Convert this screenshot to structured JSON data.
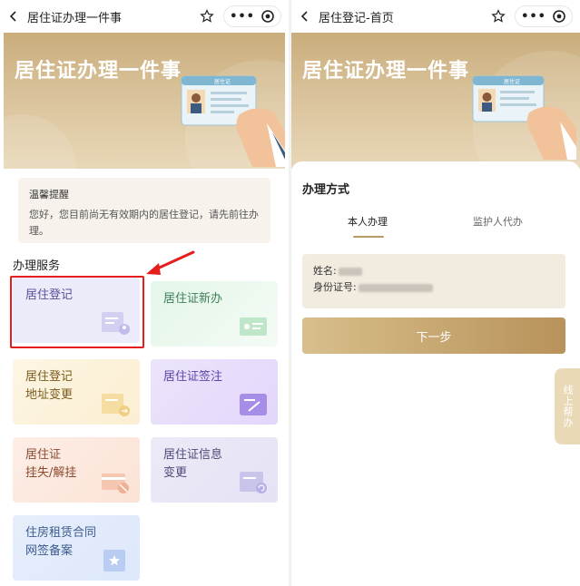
{
  "left": {
    "nav": {
      "title": "居住证办理一件事"
    },
    "banner": {
      "title": "居住证办理一件事",
      "card_label": "居住证"
    },
    "notice": {
      "title": "温馨提醒",
      "text": "您好，您目前尚无有效期内的居住登记，请先前往办理。"
    },
    "section_title": "办理服务",
    "tiles": [
      {
        "label_line1": "居住登记",
        "label_line2": "",
        "icon": "document-user-icon"
      },
      {
        "label_line1": "居住证新办",
        "label_line2": "",
        "icon": "id-card-icon"
      },
      {
        "label_line1": "居住登记",
        "label_line2": "地址变更",
        "icon": "address-change-icon"
      },
      {
        "label_line1": "居住证签注",
        "label_line2": "",
        "icon": "edit-icon"
      },
      {
        "label_line1": "居住证",
        "label_line2": "挂失/解挂",
        "icon": "card-cancel-icon"
      },
      {
        "label_line1": "居住证信息",
        "label_line2": "变更",
        "icon": "refresh-document-icon"
      },
      {
        "label_line1": "住房租赁合同",
        "label_line2": "网签备案",
        "icon": "star-document-icon"
      }
    ],
    "highlight_color": "#e51d1d"
  },
  "right": {
    "nav": {
      "title": "居住登记-首页"
    },
    "banner": {
      "title": "居住证办理一件事",
      "card_label": "居住证"
    },
    "method_title": "办理方式",
    "tabs": [
      {
        "label": "本人办理",
        "active": true
      },
      {
        "label": "监护人代办",
        "active": false
      }
    ],
    "info": {
      "name_label": "姓名:",
      "id_label": "身份证号:"
    },
    "next_button": "下一步",
    "help_button": "线上帮办"
  },
  "colors": {
    "accent_gold": "#b99a66",
    "banner_gold": "#c9ad7c"
  }
}
